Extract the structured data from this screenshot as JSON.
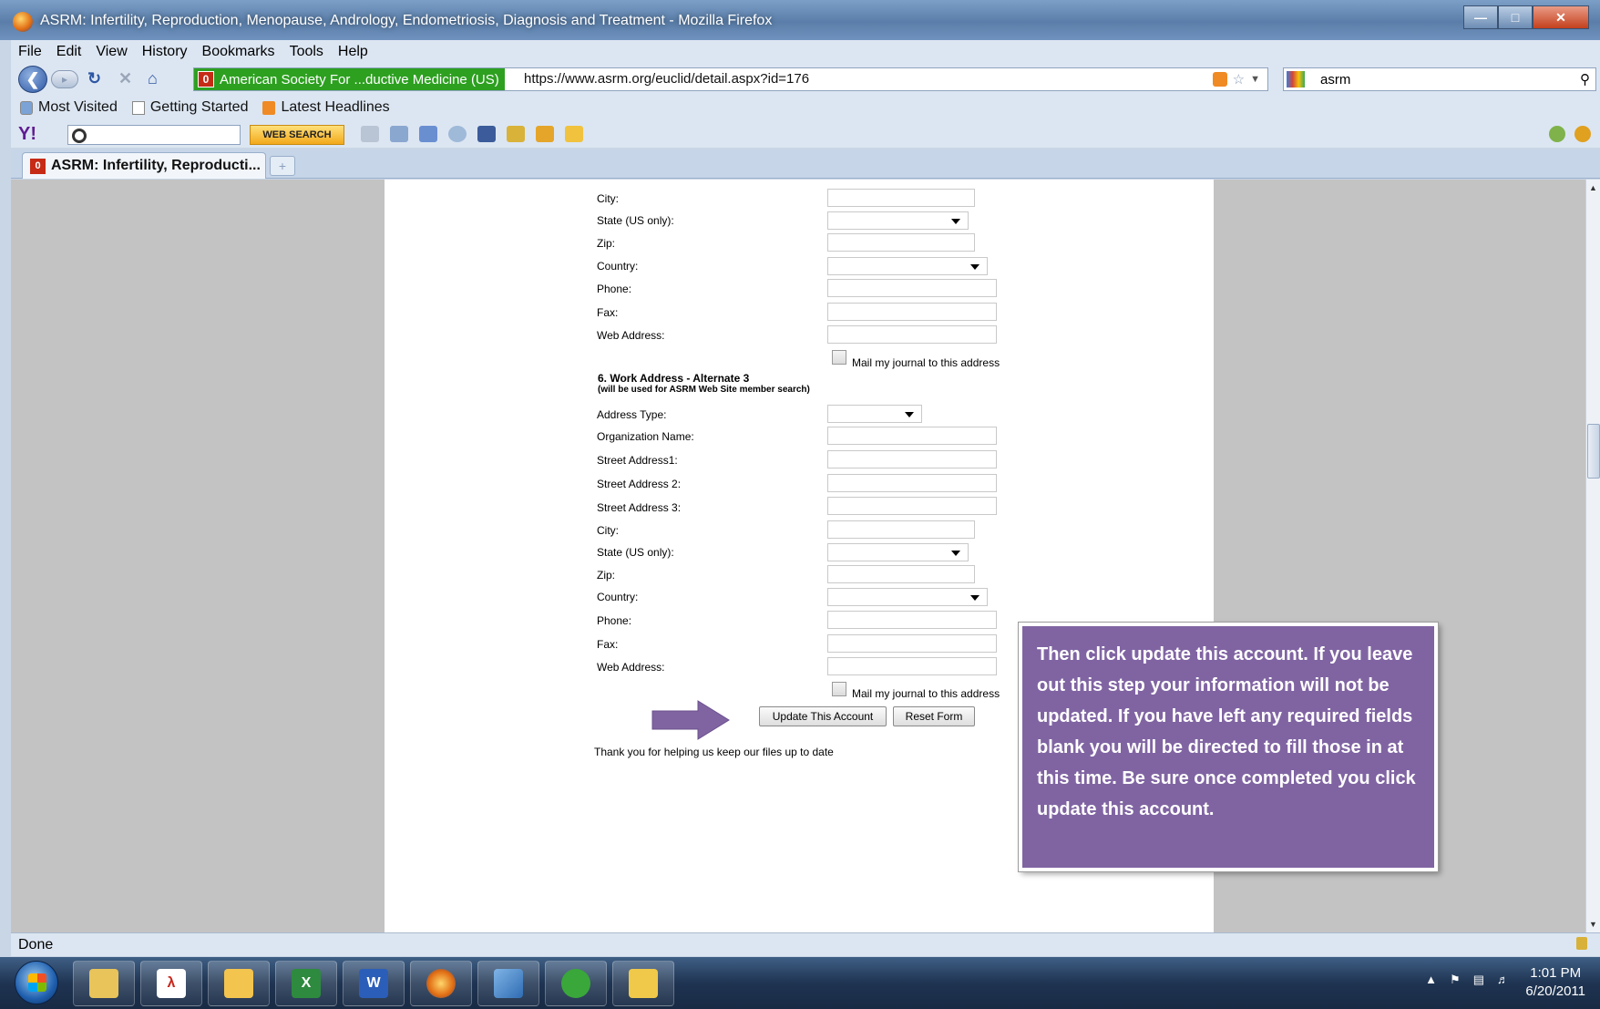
{
  "window": {
    "title": "ASRM: Infertility, Reproduction, Menopause, Andrology, Endometriosis, Diagnosis and Treatment - Mozilla Firefox"
  },
  "menu": [
    "File",
    "Edit",
    "View",
    "History",
    "Bookmarks",
    "Tools",
    "Help"
  ],
  "nav": {
    "identity": "American Society For ...ductive Medicine (US)",
    "url": "https://www.asrm.org/euclid/detail.aspx?id=176",
    "search_value": "asrm"
  },
  "bookmarks": [
    "Most Visited",
    "Getting Started",
    "Latest Headlines"
  ],
  "yahoo": {
    "search_button": "WEB SEARCH",
    "search_value": ""
  },
  "tab": {
    "title": "ASRM: Infertility, Reproducti..."
  },
  "form": {
    "section5_tail": {
      "labels": [
        "City:",
        "State (US only):",
        "Zip:",
        "Country:",
        "Phone:",
        "Fax:",
        "Web Address:"
      ],
      "mail_journal": "Mail my journal to this address"
    },
    "section6": {
      "title": "6. Work Address - Alternate 3",
      "subtitle": "(will be used for ASRM Web Site member search)",
      "labels": [
        "Address Type:",
        "Organization Name:",
        "Street Address1:",
        "Street Address 2:",
        "Street Address 3:",
        "City:",
        "State (US only):",
        "Zip:",
        "Country:",
        "Phone:",
        "Fax:",
        "Web Address:"
      ],
      "mail_journal": "Mail my journal to this address"
    },
    "update_button": "Update This Account",
    "reset_button": "Reset Form",
    "thank_you": "Thank you for helping us keep our files up to date"
  },
  "callout": {
    "text": "Then click update this account.  If you leave out this step your information will not be updated.  If you have left any required fields blank you will be directed to fill those in at this time.  Be sure once completed you click update this account.",
    "color": "#8064a2"
  },
  "status": "Done",
  "taskbar": {
    "apps": [
      "explorer-icon",
      "acrobat-icon",
      "outlook-icon",
      "excel-icon",
      "word-icon",
      "firefox-icon",
      "app-icon",
      "euclid-icon",
      "folder-icon"
    ],
    "time": "1:01 PM",
    "date": "6/20/2011"
  }
}
